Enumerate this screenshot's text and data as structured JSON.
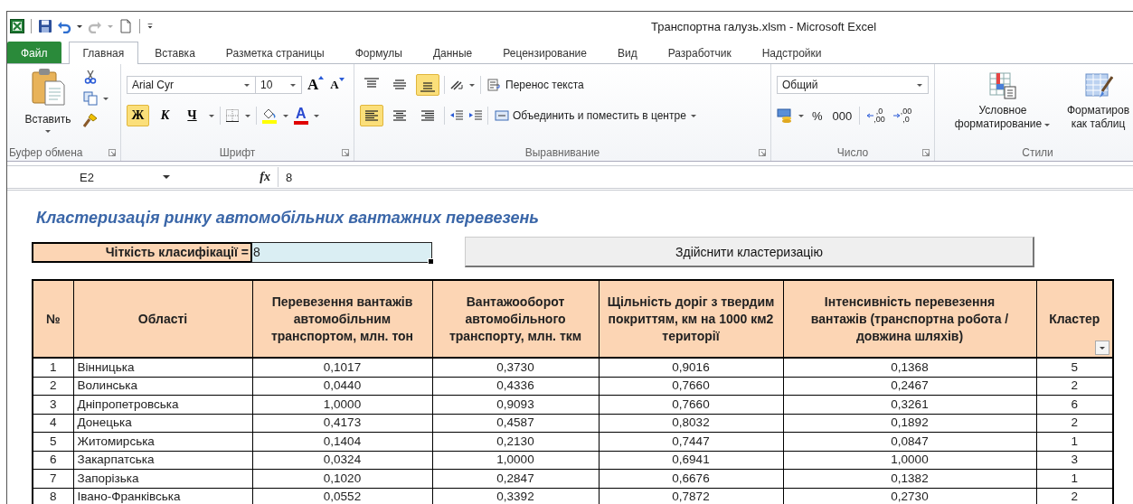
{
  "window": {
    "title": "Транспортна галузь.xlsm  -  Microsoft Excel"
  },
  "tabs": [
    {
      "label": "Файл",
      "kind": "file",
      "selected": false
    },
    {
      "label": "Главная",
      "kind": "tab",
      "selected": true
    },
    {
      "label": "Вставка",
      "kind": "tab",
      "selected": false
    },
    {
      "label": "Разметка страницы",
      "kind": "tab",
      "selected": false
    },
    {
      "label": "Формулы",
      "kind": "tab",
      "selected": false
    },
    {
      "label": "Данные",
      "kind": "tab",
      "selected": false
    },
    {
      "label": "Рецензирование",
      "kind": "tab",
      "selected": false
    },
    {
      "label": "Вид",
      "kind": "tab",
      "selected": false
    },
    {
      "label": "Разработчик",
      "kind": "tab",
      "selected": false
    },
    {
      "label": "Надстройки",
      "kind": "tab",
      "selected": false
    }
  ],
  "ribbon": {
    "clipboard": {
      "paste": "Вставить",
      "label": "Буфер обмена"
    },
    "font": {
      "name": "Arial Cyr",
      "size": "10",
      "grow": "A",
      "shrink": "A",
      "font_color": "A",
      "label": "Шрифт",
      "styles": [
        {
          "label": "Ж",
          "kind": "bold",
          "selected": true
        },
        {
          "label": "К",
          "kind": "italic",
          "selected": false
        },
        {
          "label": "Ч",
          "kind": "underline",
          "selected": false
        }
      ]
    },
    "alignment": {
      "wrap": "Перенос текста",
      "merge": "Объединить и поместить в центре",
      "label": "Выравнивание",
      "vertical": [
        {
          "kind": "top",
          "selected": false
        },
        {
          "kind": "middle",
          "selected": false
        },
        {
          "kind": "bottom",
          "selected": true
        }
      ],
      "horizontal": [
        {
          "kind": "left",
          "selected": true
        },
        {
          "kind": "center",
          "selected": false
        },
        {
          "kind": "right",
          "selected": false
        }
      ]
    },
    "number": {
      "format": "Общий",
      "percent": "%",
      "thousands": "000",
      "label": "Число",
      "decimals": [
        {
          "kind": "increase",
          "top": ",0",
          "bottom": ",00"
        },
        {
          "kind": "decrease",
          "top": ",00",
          "bottom": ",0"
        }
      ]
    },
    "styles": {
      "label": "Стили",
      "buttons": [
        {
          "kind": "conditional",
          "lines": [
            "Условное",
            "форматирование"
          ],
          "dropdown": true
        },
        {
          "kind": "table",
          "lines": [
            "Форматиров",
            "как таблиц"
          ],
          "dropdown": false
        }
      ]
    }
  },
  "formula_bar": {
    "name_box": "E2",
    "fx": "fx",
    "value": "8"
  },
  "sheet": {
    "title": "Кластеризація ринку автомобільних вантажних перевезень",
    "input": {
      "label": "Чіткість класифікації =",
      "value": "8"
    },
    "button": "Здійснити  кластеризацію",
    "table": {
      "columns": [
        {
          "label": "№",
          "filter": false
        },
        {
          "label": "Області",
          "filter": false
        },
        {
          "label": "Перевезення вантажів автомобільним транспортом, млн. тон",
          "filter": false
        },
        {
          "label": "Вантажооборот автомобільного транспорту, млн. ткм",
          "filter": false
        },
        {
          "label": "Щільність доріг з твердим покриттям, км на 1000 км2 території",
          "filter": false
        },
        {
          "label": "Інтенсивність перевезення вантажів (транспортна робота / довжина шляхів)",
          "filter": false
        },
        {
          "label": "Кластер",
          "filter": true
        }
      ],
      "rows": [
        [
          "1",
          "Вінницька",
          "0,1017",
          "0,3730",
          "0,9016",
          "0,1368",
          "5"
        ],
        [
          "2",
          "Волинська",
          "0,0440",
          "0,4336",
          "0,7660",
          "0,2467",
          "2"
        ],
        [
          "3",
          "Дніпропетровська",
          "1,0000",
          "0,9093",
          "0,7660",
          "0,3261",
          "6"
        ],
        [
          "4",
          "Донецька",
          "0,4173",
          "0,4587",
          "0,8032",
          "0,1892",
          "2"
        ],
        [
          "5",
          "Житомирська",
          "0,1404",
          "0,2130",
          "0,7447",
          "0,0847",
          "1"
        ],
        [
          "6",
          "Закарпатська",
          "0,0324",
          "1,0000",
          "0,6941",
          "1,0000",
          "3"
        ],
        [
          "7",
          "Запорізька",
          "0,1020",
          "0,2847",
          "0,6676",
          "0,1382",
          "1"
        ],
        [
          "8",
          "Івано-Франківська",
          "0,0552",
          "0,3392",
          "0,7872",
          "0,2730",
          "2"
        ]
      ]
    }
  }
}
